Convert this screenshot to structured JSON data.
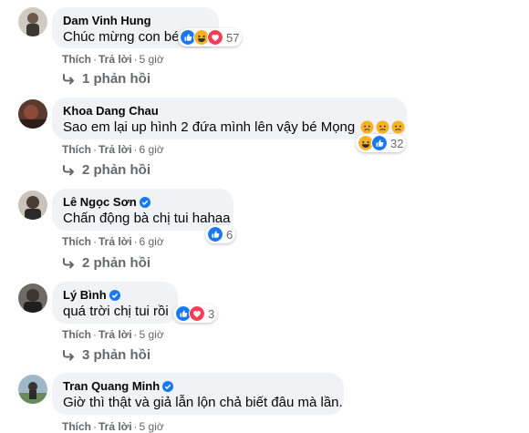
{
  "comments": [
    {
      "name": "Dam Vinh Hung",
      "text": "Chúc mừng con bé",
      "reaction_count": "57",
      "reactions": [
        "like-icon",
        "haha-icon",
        "love-icon"
      ],
      "like": "Thích",
      "reply": "Trả lời",
      "time": "5 giờ",
      "replies": "1 phản hồi",
      "verified": false
    },
    {
      "name": "Khoa Dang Chau",
      "text": "Sao em lại up hình 2 đứa mình lên vậy bé Mọng",
      "text_emojis": [
        "sad-emoji",
        "sad-emoji",
        "sad-emoji"
      ],
      "reaction_count": "32",
      "reactions": [
        "haha-icon",
        "like-icon"
      ],
      "like": "Thích",
      "reply": "Trả lời",
      "time": "6 giờ",
      "replies": "2 phản hồi",
      "verified": false
    },
    {
      "name": "Lê Ngọc Sơn",
      "text": "Chấn động bà chị tui hahaa",
      "reaction_count": "6",
      "reactions": [
        "like-icon"
      ],
      "like": "Thích",
      "reply": "Trả lời",
      "time": "6 giờ",
      "replies": "2 phản hồi",
      "verified": true
    },
    {
      "name": "Lý Bình",
      "text": "quá trời chị tui rồi",
      "reaction_count": "3",
      "reactions": [
        "like-icon",
        "love-icon"
      ],
      "like": "Thích",
      "reply": "Trả lời",
      "time": "5 giờ",
      "replies": "3 phản hồi",
      "verified": true
    },
    {
      "name": "Tran Quang Minh",
      "text": "Giờ thì thật và giả lẫn lộn chả biết đâu mà lần.",
      "like": "Thích",
      "reply": "Trả lời",
      "time": "5 giờ",
      "verified": true
    }
  ],
  "colors": {
    "like": "#1877f2",
    "love": "#f33e58",
    "haha": "#f7b125",
    "bubble": "#f0f2f5",
    "meta": "#65676b"
  }
}
